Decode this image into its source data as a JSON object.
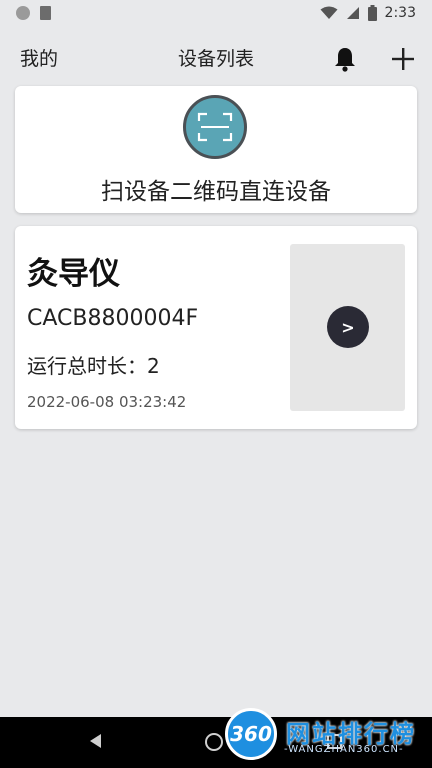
{
  "status_bar": {
    "time": "2:33",
    "icons": [
      "notification-dot-icon",
      "sd-card-icon",
      "wifi-icon",
      "signal-icon",
      "battery-icon"
    ]
  },
  "header": {
    "left_label": "我的",
    "title": "设备列表",
    "icons": [
      "bell-icon",
      "plus-icon"
    ]
  },
  "scan_card": {
    "label": "扫设备二维码直连设备",
    "icon": "qr-scan-icon",
    "colors": {
      "icon_fill": "#5aa5b5",
      "icon_border": "#4a5055"
    }
  },
  "devices": [
    {
      "name": "灸导仪",
      "serial": "CACB8800004F",
      "runtime": "运行总时长：2",
      "date": "2022-06-08 03:23:42",
      "action_label": ">"
    }
  ],
  "nav_bar": {
    "icons": [
      "back-icon",
      "home-icon",
      "recent-apps-icon"
    ]
  },
  "watermark": {
    "logo_text": "360",
    "title": "网站排行榜",
    "subtitle": "-WANGZHAN360.CN-"
  }
}
